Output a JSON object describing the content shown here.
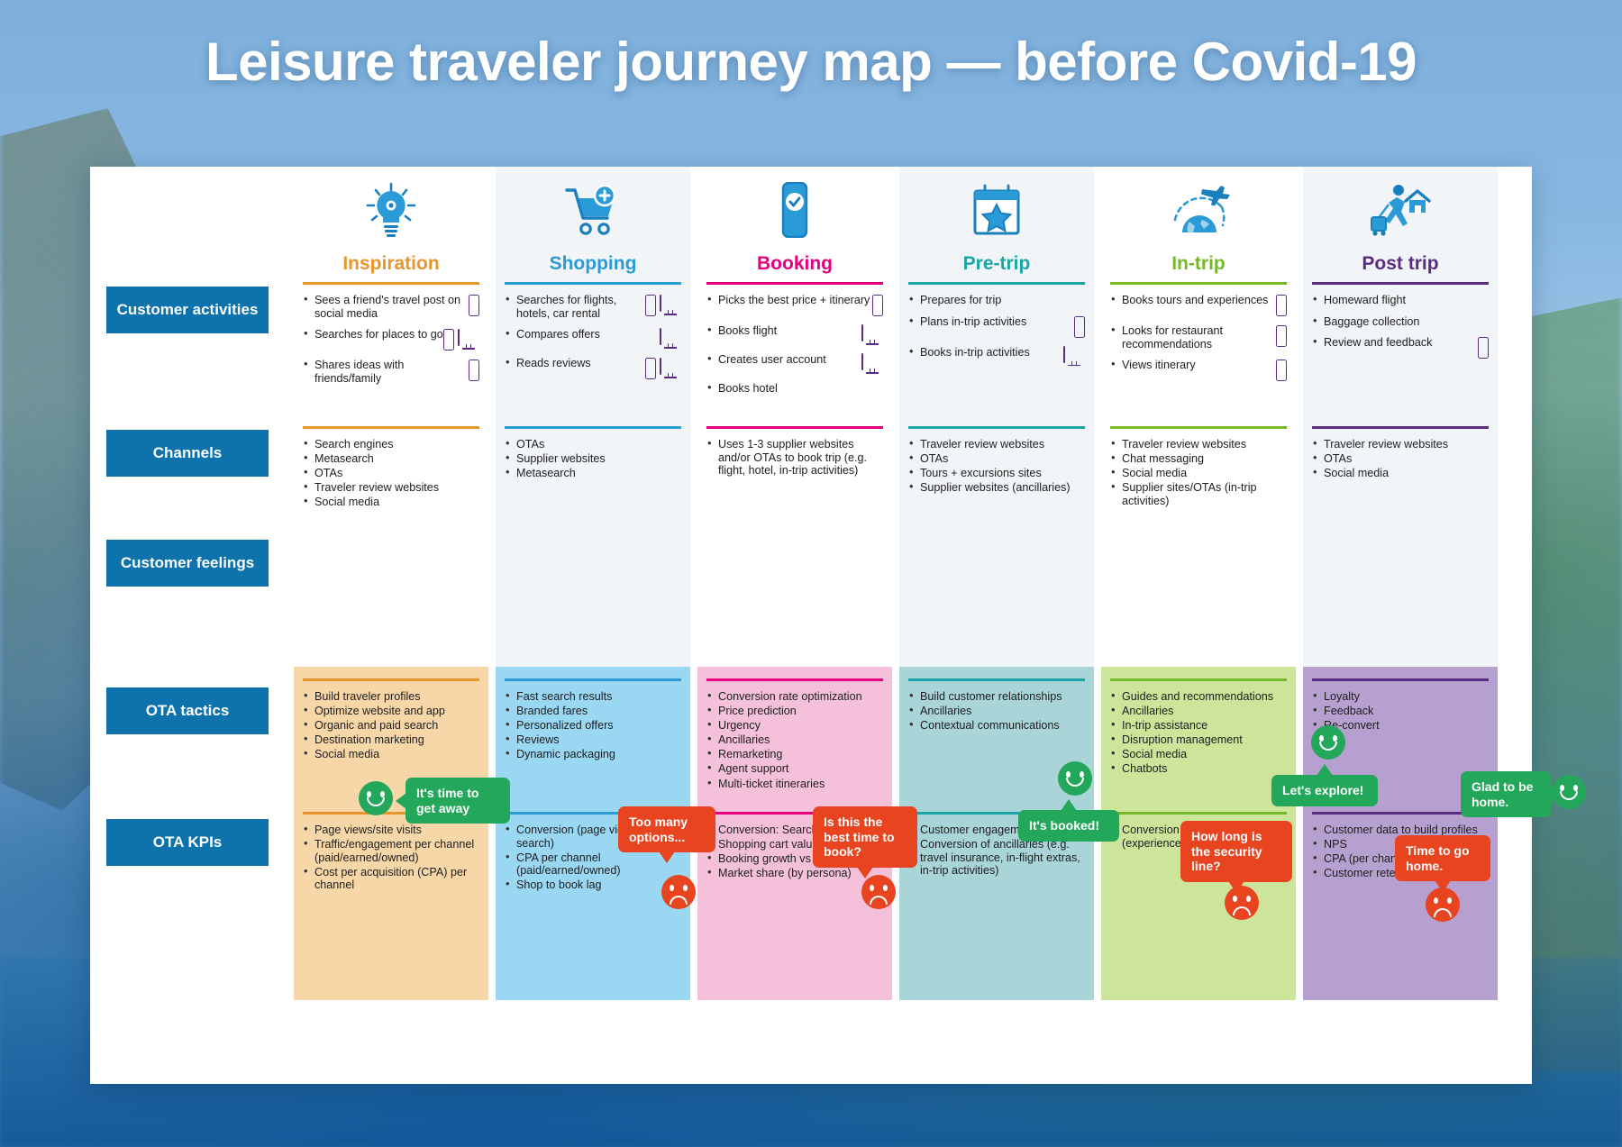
{
  "title": "Leisure traveler journey map — before Covid-19",
  "row_labels": {
    "activities": "Customer activities",
    "channels": "Channels",
    "feelings": "Customer feelings",
    "tactics": "OTA tactics",
    "kpis": "OTA KPIs"
  },
  "stages": [
    {
      "id": "inspiration",
      "label": "Inspiration",
      "color": "#e8952b",
      "icon": "lightbulb-gear-icon",
      "tint": "#f7d7a8",
      "activities": [
        {
          "text": "Sees a friend's travel post on social media",
          "devices": [
            "phone"
          ]
        },
        {
          "text": "Searches for places to go",
          "devices": [
            "phone",
            "desktop"
          ]
        },
        {
          "text": "Shares ideas with friends/family",
          "devices": [
            "phone"
          ]
        }
      ],
      "channels": [
        "Search engines",
        "Metasearch",
        "OTAs",
        "Traveler review websites",
        "Social media"
      ],
      "tactics": [
        "Build traveler profiles",
        "Optimize website and app",
        "Organic and paid search",
        "Destination marketing",
        "Social media"
      ],
      "kpis": [
        "Page views/site visits",
        "Traffic/engagement per channel (paid/earned/owned)",
        "Cost per acquisition (CPA) per channel"
      ]
    },
    {
      "id": "shopping",
      "label": "Shopping",
      "color": "#2b9bd8",
      "icon": "shopping-cart-plus-icon",
      "tint": "#9ad7f3",
      "activities": [
        {
          "text": "Searches for flights, hotels, car rental",
          "devices": [
            "phone",
            "desktop"
          ]
        },
        {
          "text": "Compares offers",
          "devices": [
            "desktop"
          ]
        },
        {
          "text": "Reads reviews",
          "devices": [
            "phone",
            "desktop"
          ]
        }
      ],
      "channels": [
        "OTAs",
        "Supplier websites",
        "Metasearch"
      ],
      "tactics": [
        "Fast search results",
        "Branded fares",
        "Personalized offers",
        "Reviews",
        "Dynamic packaging"
      ],
      "kpis": [
        "Conversion (page view to search)",
        "CPA per channel (paid/earned/owned)",
        "Shop to book lag"
      ]
    },
    {
      "id": "booking",
      "label": "Booking",
      "color": "#e4007f",
      "icon": "mobile-check-icon",
      "tint": "#f5c0da",
      "activities": [
        {
          "text": "Picks the best price + itinerary",
          "devices": [
            "phone"
          ]
        },
        {
          "text": "Books flight",
          "devices": [
            "desktop"
          ]
        },
        {
          "text": "Creates user account",
          "devices": [
            "desktop"
          ]
        },
        {
          "text": "Books hotel",
          "devices": []
        }
      ],
      "channels": [
        "Uses 1-3 supplier websites and/or OTAs to book trip (e.g. flight, hotel, in-trip activities)"
      ],
      "tactics": [
        "Conversion rate optimization",
        "Price prediction",
        "Urgency",
        "Ancillaries",
        "Remarketing",
        "Agent support",
        "Multi-ticket itineraries"
      ],
      "kpis": [
        "Conversion: Search to book",
        "Shopping cart value",
        "Booking growth vs competition",
        "Market share (by persona)"
      ]
    },
    {
      "id": "pretrip",
      "label": "Pre-trip",
      "color": "#1aa6a6",
      "icon": "calendar-star-icon",
      "tint": "#a9d4d8",
      "activities": [
        {
          "text": "Prepares for trip",
          "devices": []
        },
        {
          "text": "Plans in-trip activities",
          "devices": [
            "phone"
          ]
        },
        {
          "text": "Books in-trip activities",
          "devices": [
            "desktop"
          ]
        }
      ],
      "channels": [
        "Traveler review websites",
        "OTAs",
        "Tours + excursions sites",
        "Supplier websites (ancillaries)"
      ],
      "tactics": [
        "Build customer relationships",
        "Ancillaries",
        "Contextual communications"
      ],
      "kpis": [
        "Customer engagement",
        "Conversion of ancillaries (e.g. travel insurance, in-flight extras, in-trip activities)"
      ]
    },
    {
      "id": "intrip",
      "label": "In-trip",
      "color": "#76b82a",
      "icon": "globe-plane-icon",
      "tint": "#cde59a",
      "activities": [
        {
          "text": "Books tours and experiences",
          "devices": [
            "phone"
          ]
        },
        {
          "text": "Looks for restaurant recommendations",
          "devices": [
            "phone"
          ]
        },
        {
          "text": "Views itinerary",
          "devices": [
            "phone"
          ]
        }
      ],
      "channels": [
        "Traveler review websites",
        "Chat messaging",
        "Social media",
        "Supplier sites/OTAs (in-trip activities)"
      ],
      "tactics": [
        "Guides and recommendations",
        "Ancillaries",
        "In-trip assistance",
        "Disruption management",
        "Social media",
        "Chatbots"
      ],
      "kpis": [
        "Conversion of ancillaries (experiences, in-trip activities)"
      ]
    },
    {
      "id": "posttrip",
      "label": "Post trip",
      "color": "#5b2d82",
      "icon": "traveler-home-icon",
      "tint": "#b6a0d0",
      "activities": [
        {
          "text": "Homeward flight",
          "devices": []
        },
        {
          "text": "Baggage collection",
          "devices": []
        },
        {
          "text": "Review and feedback",
          "devices": [
            "phone"
          ]
        }
      ],
      "channels": [
        "Traveler review websites",
        "OTAs",
        "Social media"
      ],
      "tactics": [
        "Loyalty",
        "Feedback",
        "Re-convert"
      ],
      "kpis": [
        "Customer data to build profiles",
        "NPS",
        "CPA (per channel)",
        "Customer retention"
      ]
    }
  ],
  "feelings": [
    {
      "id": "inspiration-feeling",
      "mood": "happy",
      "text": "It's time to get away"
    },
    {
      "id": "shopping-feeling",
      "mood": "sad",
      "text": "Too many options..."
    },
    {
      "id": "booking-feeling",
      "mood": "sad",
      "text": "Is this the best time to book?"
    },
    {
      "id": "pretrip-feeling",
      "mood": "happy",
      "text": "It's booked!"
    },
    {
      "id": "intrip-feeling-sad",
      "mood": "sad",
      "text": "How long is the security line?"
    },
    {
      "id": "intrip-feeling-happy",
      "mood": "happy",
      "text": "Let's explore!"
    },
    {
      "id": "posttrip-feeling-sad",
      "mood": "sad",
      "text": "Time to go home."
    },
    {
      "id": "posttrip-feeling-happy",
      "mood": "happy",
      "text": "Glad to be home."
    }
  ],
  "colors": {
    "row_label_bg": "#0e72ad",
    "happy": "#22a75b",
    "sad": "#e8441f",
    "device_outline": "#5b2d82"
  }
}
